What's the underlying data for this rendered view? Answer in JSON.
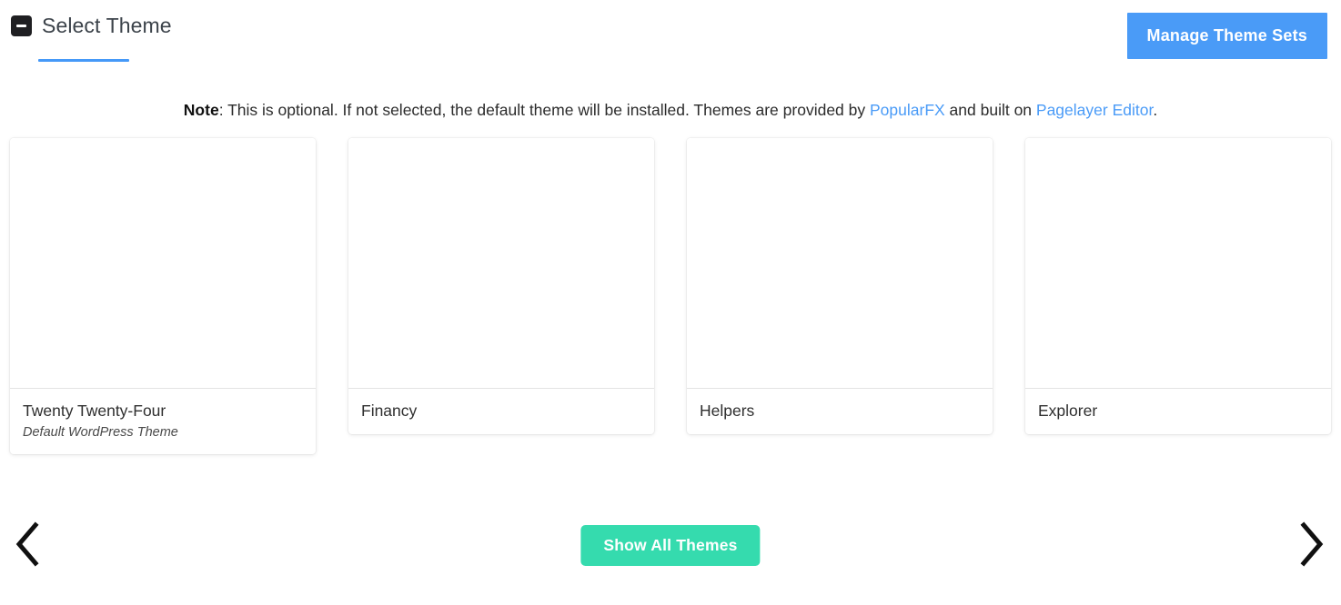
{
  "header": {
    "title": "Select Theme",
    "collapse_icon": "minus-square-icon",
    "manage_button_label": "Manage Theme Sets",
    "accent_color": "#4a9bf7",
    "underline_color": "#4599f8"
  },
  "note": {
    "label": "Note",
    "part1": ": This is optional. If not selected, the default theme will be installed. Themes are provided by ",
    "link1": "PopularFX",
    "part2": " and built on ",
    "link2": "Pagelayer Editor",
    "part3": "."
  },
  "themes": [
    {
      "title": "Twenty Twenty-Four",
      "subtitle": "Default WordPress Theme"
    },
    {
      "title": "Financy",
      "subtitle": ""
    },
    {
      "title": "Helpers",
      "subtitle": ""
    },
    {
      "title": "Explorer",
      "subtitle": ""
    }
  ],
  "footer": {
    "prev_icon": "chevron-left-icon",
    "next_icon": "chevron-right-icon",
    "show_all_label": "Show All Themes",
    "show_all_color": "#35dbae"
  }
}
